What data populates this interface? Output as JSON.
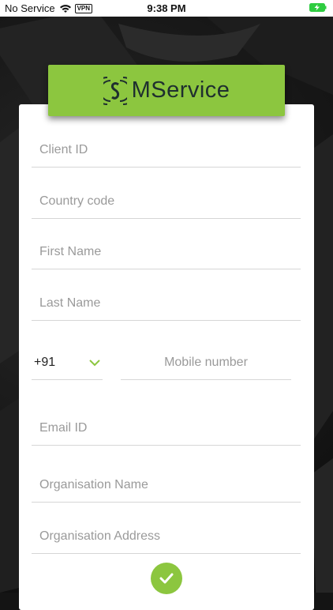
{
  "status_bar": {
    "carrier": "No Service",
    "vpn": "VPN",
    "time": "9:38 PM"
  },
  "app": {
    "name": "MService",
    "brand_color": "#8cc63f"
  },
  "form": {
    "client_id": {
      "placeholder": "Client ID"
    },
    "country_code": {
      "placeholder": "Country code"
    },
    "first_name": {
      "placeholder": "First Name"
    },
    "last_name": {
      "placeholder": "Last Name"
    },
    "dial_code": {
      "value": "+91"
    },
    "mobile": {
      "placeholder": "Mobile number"
    },
    "email": {
      "placeholder": "Email ID"
    },
    "org_name": {
      "placeholder": "Organisation Name"
    },
    "org_address": {
      "placeholder": "Organisation Address"
    }
  },
  "icons": {
    "submit": "check-icon",
    "dial_dropdown": "chevron-down-icon"
  }
}
